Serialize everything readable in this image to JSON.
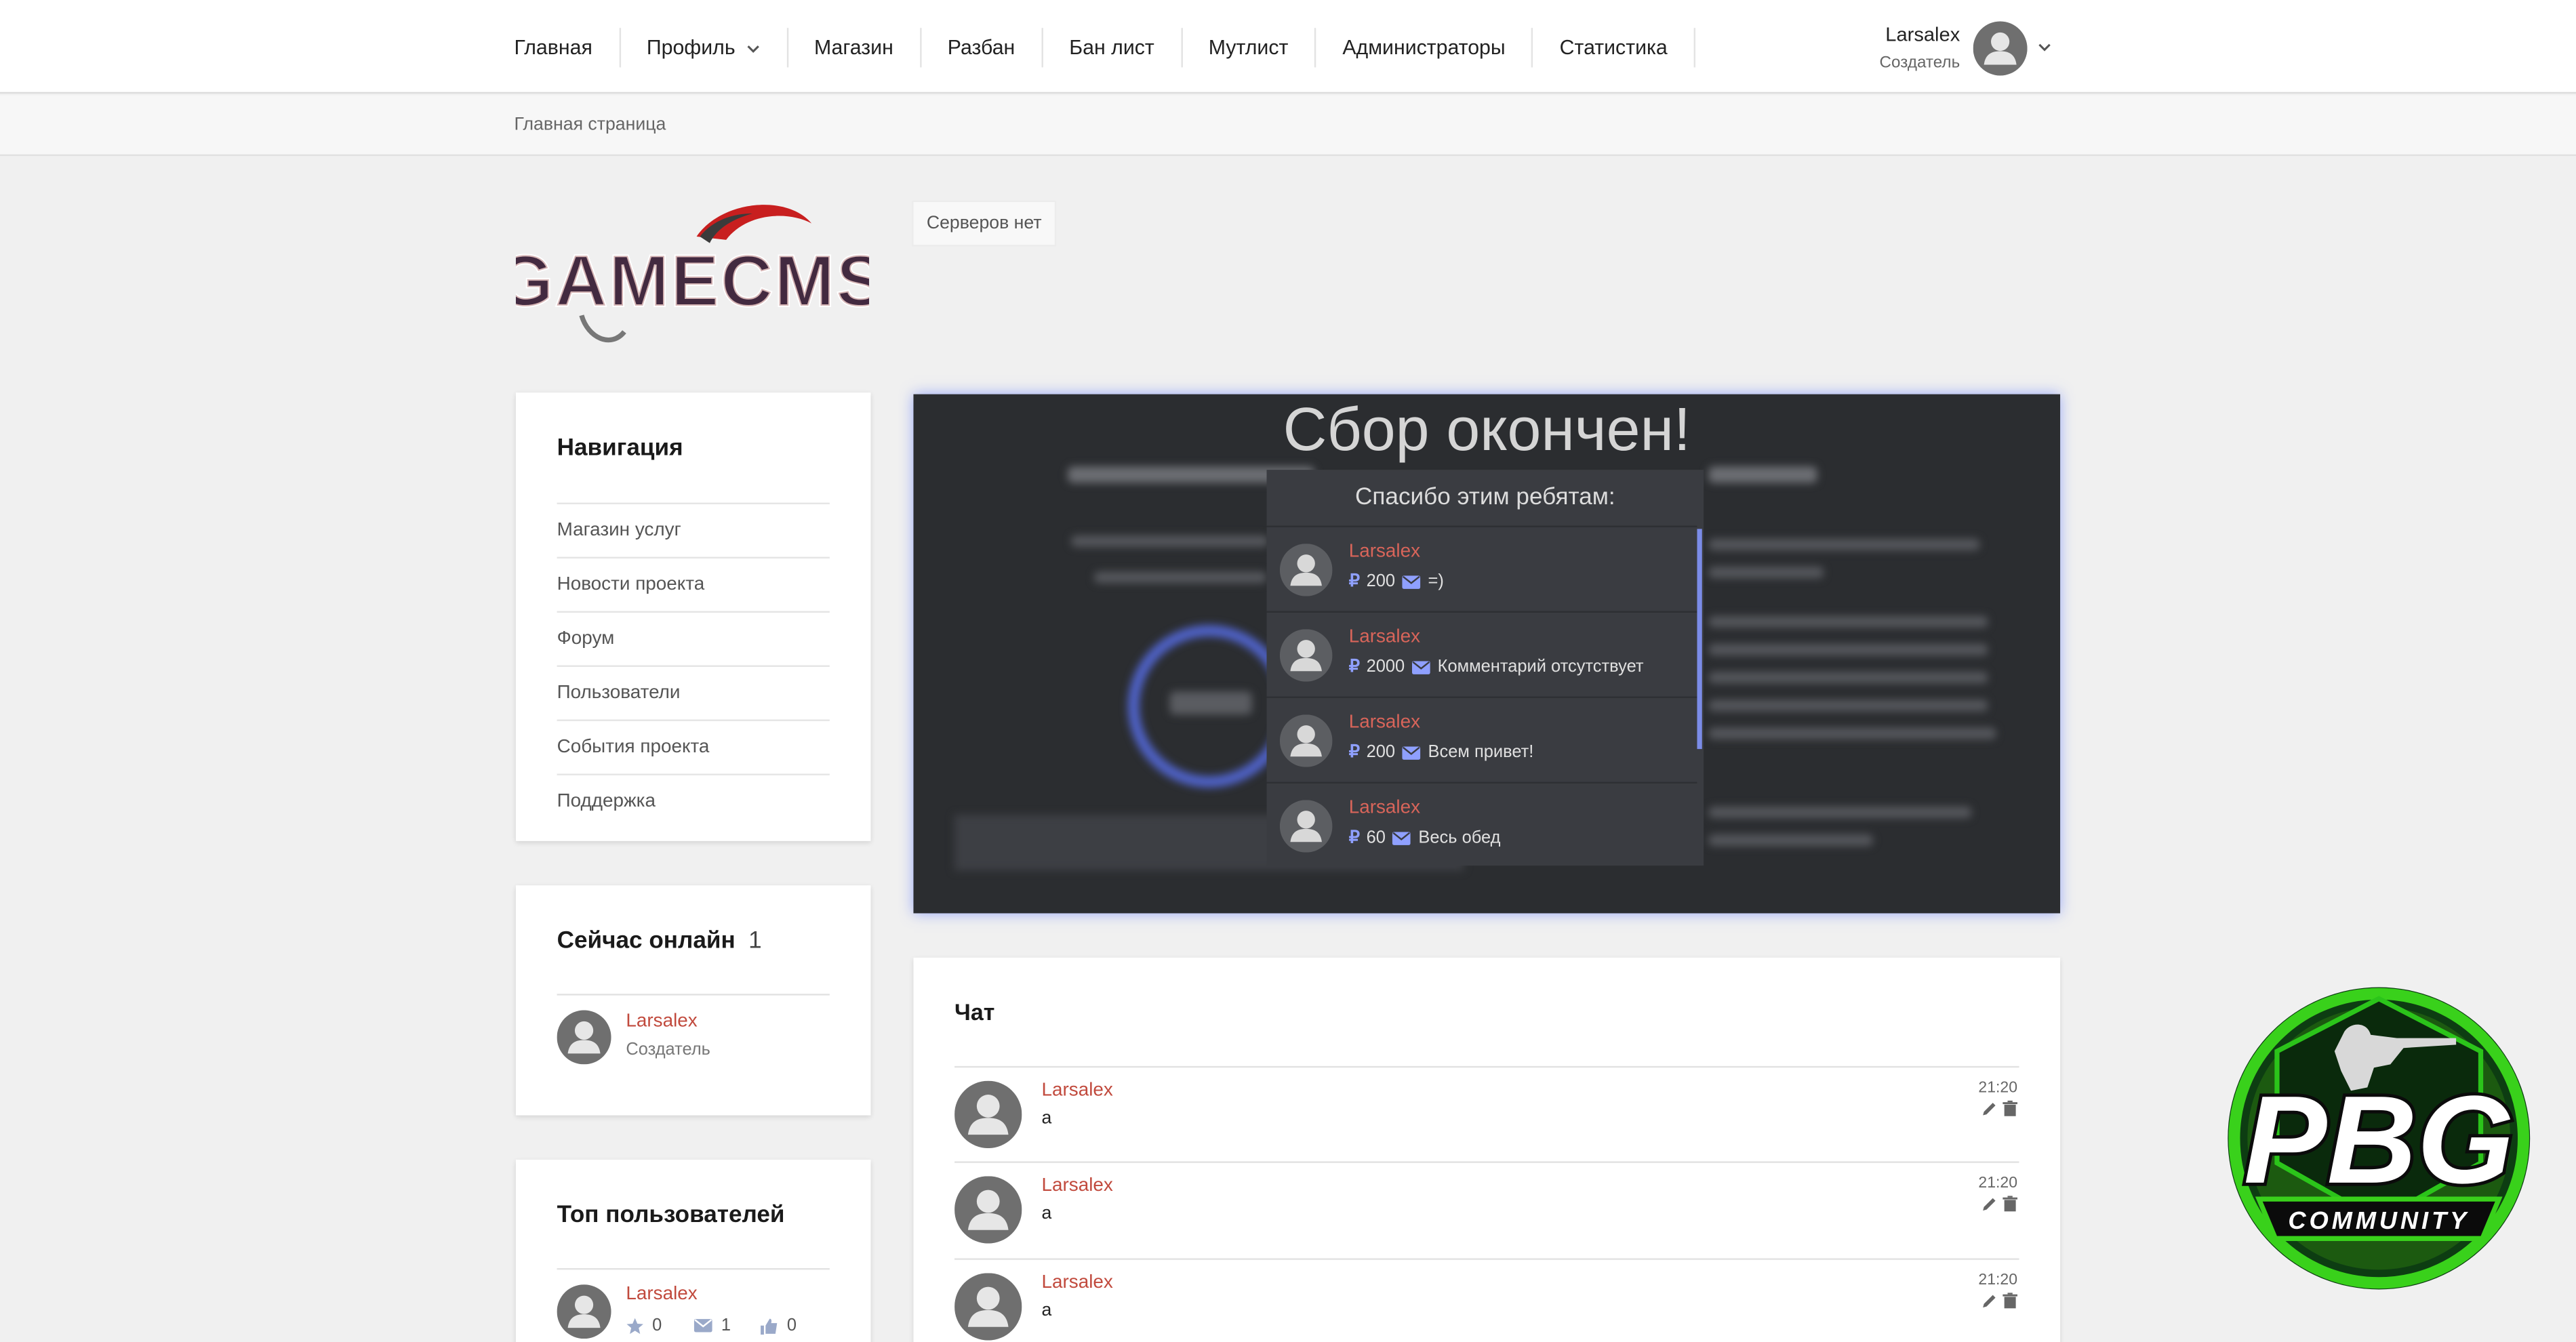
{
  "nav": {
    "home": "Главная",
    "profile": "Профиль",
    "shop": "Магазин",
    "unban": "Разбан",
    "banlist": "Бан лист",
    "mutelist": "Мутлист",
    "admins": "Администраторы",
    "stats": "Статистика"
  },
  "user": {
    "name": "Larsalex",
    "role": "Создатель"
  },
  "breadcrumb": "Главная страница",
  "logo": {
    "text": "GAMECMS"
  },
  "servers": "Серверов нет",
  "navigation": {
    "title": "Навигация",
    "items": [
      "Магазин услуг",
      "Новости проекта",
      "Форум",
      "Пользователи",
      "События проекта",
      "Поддержка"
    ]
  },
  "online": {
    "title": "Сейчас онлайн",
    "count": "1",
    "user": {
      "name": "Larsalex",
      "role": "Создатель"
    }
  },
  "top_users": {
    "title": "Топ пользователей",
    "user": {
      "name": "Larsalex",
      "stars": "0",
      "messages": "1",
      "likes": "0"
    }
  },
  "donation": {
    "title": "Сбор окончен!",
    "thanks_title": "Спасибо этим ребятам:",
    "currency": "₽",
    "donors": [
      {
        "name": "Larsalex",
        "amount": "200",
        "comment": "=)"
      },
      {
        "name": "Larsalex",
        "amount": "2000",
        "comment": "Комментарий отсутствует"
      },
      {
        "name": "Larsalex",
        "amount": "200",
        "comment": "Всем привет!"
      },
      {
        "name": "Larsalex",
        "amount": "60",
        "comment": "Весь обед"
      }
    ]
  },
  "chat": {
    "title": "Чат",
    "messages": [
      {
        "name": "Larsalex",
        "text": "a",
        "time": "21:20"
      },
      {
        "name": "Larsalex",
        "text": "a",
        "time": "21:20"
      },
      {
        "name": "Larsalex",
        "text": "a",
        "time": "21:20"
      }
    ]
  },
  "badge": {
    "text": "PBG",
    "subtext": "COMMUNITY"
  },
  "colors": {
    "accent_name": "#c14a3d",
    "donor_name": "#d9655a",
    "glow": "#6f86ff",
    "badge_green": "#39d11b"
  }
}
